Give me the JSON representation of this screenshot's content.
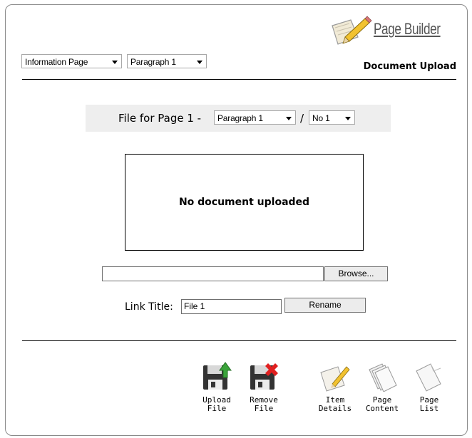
{
  "header": {
    "logo_text": "Page Builder",
    "section_title": "Document Upload",
    "page_type_select": "Information Page",
    "paragraph_select": "Paragraph 1"
  },
  "file_bar": {
    "label": "File for Page 1 -",
    "paragraph_select": "Paragraph 1",
    "separator": "/",
    "number_select": "No 1"
  },
  "preview": {
    "text": "No document uploaded"
  },
  "upload": {
    "path_value": "",
    "browse_label": "Browse..."
  },
  "link": {
    "label": "Link Title:",
    "value": "File 1",
    "rename_label": "Rename"
  },
  "toolbar": [
    {
      "id": "upload",
      "label": "Upload\nFile",
      "icon": "upload-disk-icon"
    },
    {
      "id": "remove",
      "label": "Remove\nFile",
      "icon": "remove-disk-icon"
    },
    {
      "id": "details",
      "label": "Item\nDetails",
      "icon": "edit-page-icon"
    },
    {
      "id": "content",
      "label": "Page\nContent",
      "icon": "pages-stack-icon"
    },
    {
      "id": "list",
      "label": "Page\nList",
      "icon": "page-icon"
    }
  ],
  "colors": {
    "upload_arrow": "#3aa33a",
    "remove_x": "#e02020",
    "disk": "#333333"
  }
}
